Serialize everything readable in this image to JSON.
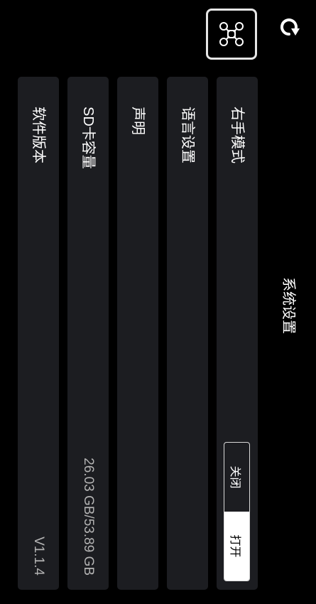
{
  "header": {
    "title": "系统设置",
    "back_icon": "refresh-back-icon",
    "drone_icon": "drone-icon"
  },
  "settings": [
    {
      "label": "右手模式",
      "type": "toggle",
      "options": [
        "关闭",
        "打开"
      ],
      "selected": "关闭"
    },
    {
      "label": "语言设置",
      "type": "link"
    },
    {
      "label": "声明",
      "type": "link"
    },
    {
      "label": "SD卡容量",
      "type": "value",
      "value": "26.03 GB/53.89 GB"
    },
    {
      "label": "软件版本",
      "type": "value",
      "value": "V1.1.4"
    }
  ],
  "colors": {
    "background": "#000000",
    "row_background": "#1c1d21",
    "text": "#ffffff",
    "muted_text": "#b3b3b3",
    "toggle_selected_bg": "#ffffff",
    "toggle_selected_text": "#000000"
  }
}
